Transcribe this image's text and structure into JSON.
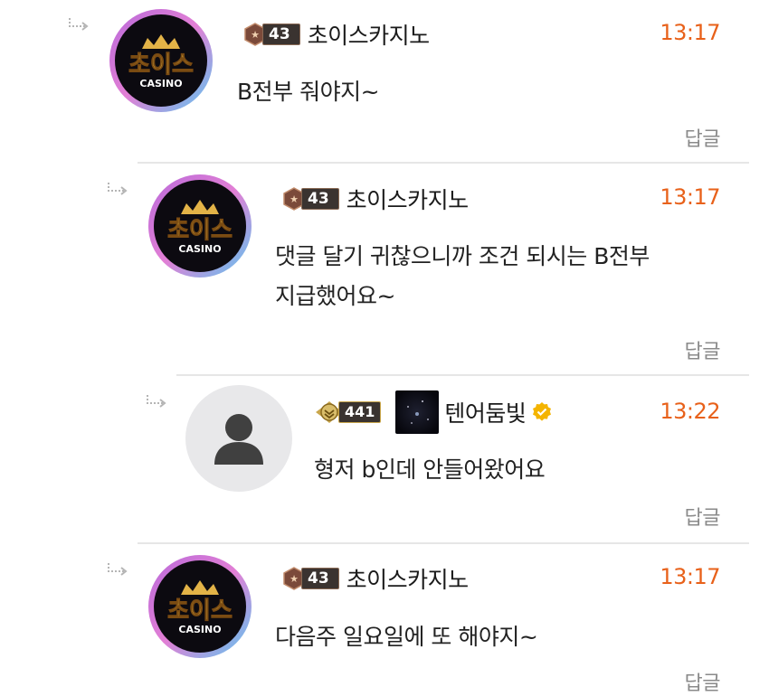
{
  "comments": [
    {
      "level": "43",
      "nickname": "초이스카지노",
      "time": "13:17",
      "lines": [
        "B전부 줘야지~"
      ],
      "reply_label": "답글"
    },
    {
      "level": "43",
      "nickname": "초이스카지노",
      "time": "13:17",
      "lines": [
        "댓글 달기 귀찮으니까 조건 되시는 B전부",
        "지급했어요~"
      ],
      "reply_label": "답글"
    },
    {
      "level": "441",
      "nickname": "텐어둠빛",
      "time": "13:22",
      "lines": [
        "형저 b인데 안들어왔어요"
      ],
      "reply_label": "답글"
    },
    {
      "level": "43",
      "nickname": "초이스카지노",
      "time": "13:17",
      "lines": [
        "다음주 일요일에 또 해야지~"
      ],
      "reply_label": "답글"
    }
  ],
  "logo": {
    "main": "초이스",
    "sub": "CASINO"
  },
  "colors": {
    "time": "#e8611a",
    "reply": "#8a8a8a",
    "divider": "#e6e6e6",
    "verified": "#f4b400"
  },
  "icons": {
    "reply_arrow": "reply-arrow-icon",
    "level_badge": "level-badge-icon",
    "gold_badge": "gold-rank-icon",
    "verified": "verified-check-icon",
    "default_avatar": "person-icon"
  }
}
